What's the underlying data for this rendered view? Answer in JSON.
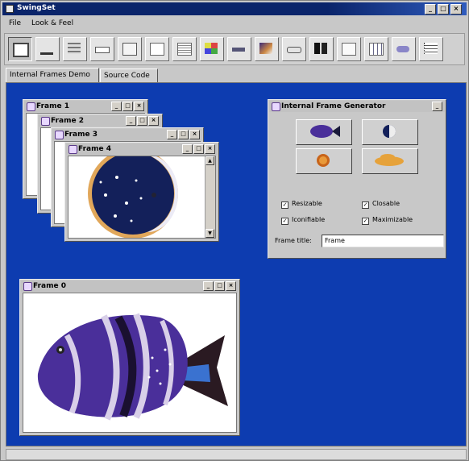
{
  "window": {
    "title": "SwingSet",
    "controls": [
      "_",
      "□",
      "×"
    ]
  },
  "menu": {
    "items": [
      "File",
      "Look & Feel"
    ]
  },
  "toolbar": {
    "icons": [
      "internal-frames-icon",
      "button-icon",
      "checkbox-icon",
      "combobox-icon",
      "file-chooser-icon",
      "list-icon",
      "option-pane-icon",
      "color-chooser-icon",
      "progress-bar-icon",
      "scroll-pane-icon",
      "slider-icon",
      "split-pane-icon",
      "tabbed-pane-icon",
      "table-icon",
      "text-icon",
      "tree-icon"
    ]
  },
  "tabs": [
    "Internal Frames Demo",
    "Source Code"
  ],
  "frames": {
    "frame1": "Frame 1",
    "frame2": "Frame 2",
    "frame3": "Frame 3",
    "frame4": "Frame 4",
    "frame0": "Frame 0"
  },
  "frame_controls": [
    "_",
    "□",
    "×"
  ],
  "generator": {
    "title": "Internal Frame Generator",
    "min_control": "_",
    "resizable": "Resizable",
    "closable": "Closable",
    "iconifiable": "Iconifiable",
    "maximizable": "Maximizable",
    "check_mark": "✓",
    "frame_title_label": "Frame title:",
    "frame_title_value": "Frame"
  },
  "colors": {
    "desktop": "#0d3cb0",
    "title_bar": "#0a246a",
    "fish_purple": "#4a2f9a",
    "moon_navy": "#13205a"
  }
}
